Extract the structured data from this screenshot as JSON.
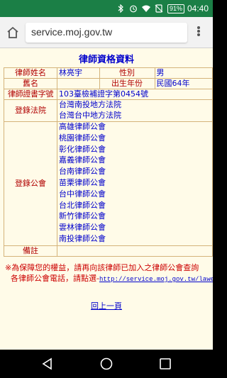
{
  "status": {
    "battery": "91%",
    "time": "04:40",
    "icons": [
      "bluetooth-icon",
      "alarm-icon",
      "wifi-icon",
      "no-sim-icon",
      "battery-icon"
    ]
  },
  "browser": {
    "url": "service.moj.gov.tw",
    "icons": [
      "home-icon",
      "menu-icon"
    ]
  },
  "page": {
    "title": "律師資格資料",
    "name_label": "律師姓名",
    "name_value": "林亮宇",
    "gender_label": "性別",
    "gender_value": "男",
    "former_name_label": "舊名",
    "former_name_value": "",
    "birth_year_label": "出生年份",
    "birth_year_value": "民國64年",
    "cert_label": "律師證書字號",
    "cert_value": "103臺檢補證字第0454號",
    "court_label": "登錄法院",
    "courts": [
      "台灣南投地方法院",
      "台灣台中地方法院"
    ],
    "bar_label": "登錄公會",
    "bars": [
      "高雄律師公會",
      "桃園律師公會",
      "彰化律師公會",
      "嘉義律師公會",
      "台南律師公會",
      "苗栗律師公會",
      "台中律師公會",
      "台北律師公會",
      "新竹律師公會",
      "雲林律師公會",
      "南投律師公會"
    ],
    "remarks_label": "備註",
    "remarks_value": "",
    "notice_line1": "※為保障您的權益，請再向該律師已加入之律師公會查詢",
    "notice_line2": "各律師公會電話，請點選-",
    "notice_url": "http://service.moj.gov.tw/lawer/notice.htm",
    "back_link": "回上一頁"
  },
  "nav": {
    "icons": [
      "back-icon",
      "home-circle-icon",
      "recents-icon"
    ]
  },
  "colors": {
    "status_bar": "#1b7f46",
    "page_background": "#fffbe8",
    "label_text": "#b00000",
    "value_text": "#0000cc",
    "table_border": "#d4b37a",
    "notice_text": "#cc0000"
  }
}
